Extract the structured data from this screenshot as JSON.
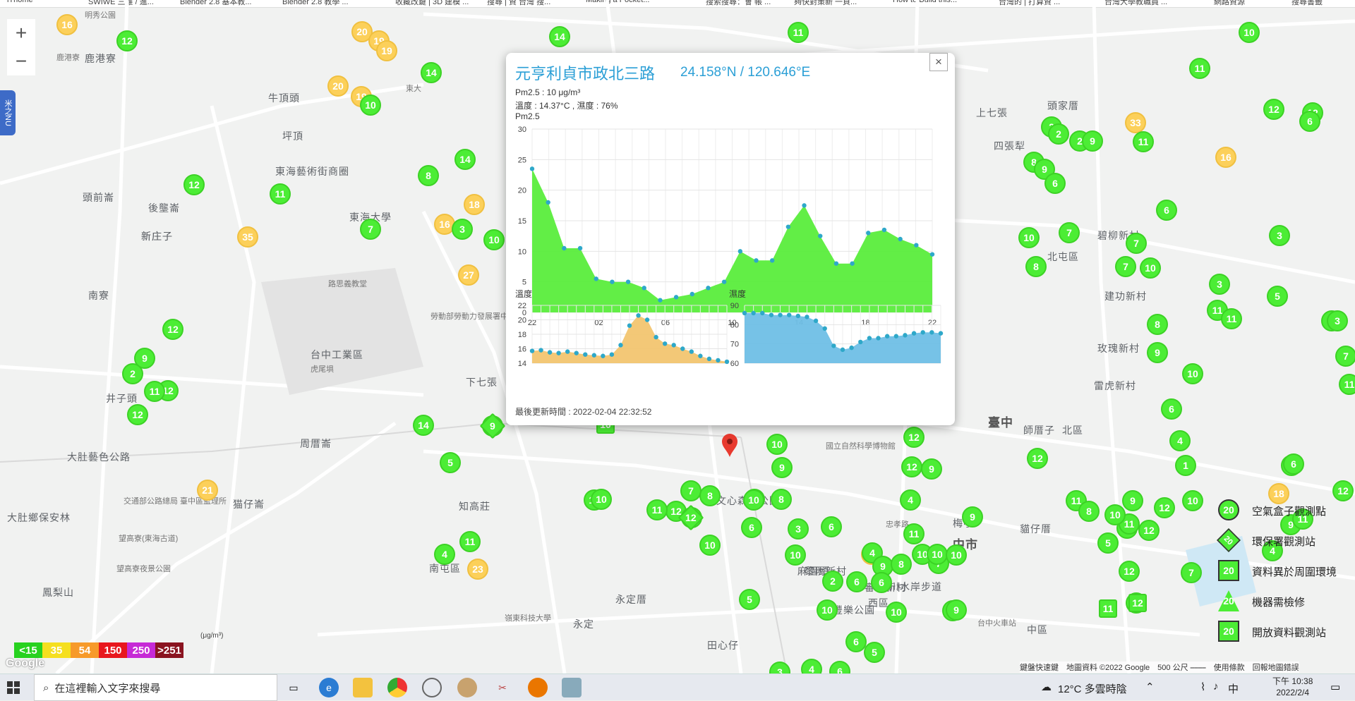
{
  "bookmarks": [
    "iThome",
    "SWIWE 三維 / 進...",
    "Blender 2.8 基本教...",
    "Blender 2.8 教學 ...",
    "收藏改鍵 | 3D 建模 ...",
    "搜尋 | 資 台灣 搜...",
    "Making a Pocket...",
    "搜索搜尋：會 帳 ...",
    "夠快對策新 一頁...",
    "How to Build this...",
    "台灣的 | 打算資 ...",
    "台灣大學教職員 ...",
    "網路資源",
    "搜尋書籤"
  ],
  "map": {
    "zoom_in": "+",
    "zoom_out": "−",
    "side_tab": "米之NU",
    "labels": [
      "明秀公園",
      "鹿港寮",
      "東大",
      "牛頂頭",
      "坪頂",
      "東海藝術街商圈",
      "頭前崙",
      "後壟崙",
      "新庄子",
      "南寮",
      "路思義教堂",
      "台中工業區",
      "虎尾埧",
      "井子頭",
      "周厝崙",
      "大肚藝色公路",
      "交通部公路總局 臺中區監理所",
      "大肚鄉保安林",
      "望高寮(東海古道)",
      "望高寮夜景公園",
      "鳳梨山",
      "勞動部勞動力發展署中彰投分署(臺中職訓局)",
      "下七張",
      "知高莊",
      "國立自然科學博物館",
      "中市",
      "臺中",
      "師厝子",
      "西區",
      "審計新村",
      "忠孝路",
      "梅亭",
      "北屯區",
      "北區",
      "四張犁",
      "上七張",
      "頭家厝",
      "碧柳新村",
      "玫瑰新村",
      "建功新村",
      "雷虎新村",
      "永定厝",
      "永定",
      "田心仔",
      "南屯區",
      "嶺東科技大學",
      "豐樂公園",
      "中區",
      "柳川水岸步道",
      "台中火車站",
      "鹿港寮",
      "麻園頭",
      "黎明新村",
      "文心森林公園",
      "新庄子",
      "猫仔崙",
      "東海大學",
      "貓仔厝"
    ],
    "marker_values": [
      "16",
      "12",
      "20",
      "19",
      "19",
      "20",
      "19",
      "10",
      "14",
      "14",
      "14",
      "11",
      "12",
      "11",
      "8",
      "7",
      "35",
      "18",
      "16",
      "27",
      "3",
      "10",
      "12",
      "12",
      "9",
      "2",
      "11",
      "12",
      "14",
      "5",
      "9",
      "21",
      "23",
      "4",
      "11",
      "10",
      "10",
      "12",
      "11",
      "7",
      "12",
      "8",
      "10",
      "6",
      "9",
      "10",
      "10",
      "8",
      "9",
      "5",
      "10",
      "4",
      "4",
      "9",
      "6",
      "6",
      "8",
      "4",
      "10",
      "11",
      "7",
      "10",
      "9",
      "10",
      "9",
      "10",
      "10",
      "2",
      "6",
      "5",
      "4",
      "6",
      "3",
      "3",
      "9",
      "12",
      "12",
      "9",
      "6",
      "12",
      "11",
      "8",
      "4",
      "12",
      "11",
      "4",
      "9",
      "8",
      "10",
      "1",
      "10",
      "6",
      "12",
      "9",
      "10",
      "5",
      "12",
      "11",
      "7",
      "18",
      "1",
      "6",
      "9",
      "4",
      "11",
      "12",
      "11",
      "7",
      "7",
      "3",
      "16",
      "33",
      "11",
      "2",
      "2",
      "2",
      "9",
      "8",
      "9",
      "6",
      "7",
      "10",
      "8",
      "7",
      "7",
      "6",
      "3",
      "11",
      "10",
      "5",
      "11",
      "12",
      "6",
      "11",
      "10",
      "12",
      "3",
      "11"
    ],
    "footer": "鍵盤快速鍵　地圖資料 ©2022 Google　500 公尺 ⎯⎯⎯⎯　使用條款　回報地圖錯誤",
    "google": "Google"
  },
  "popup": {
    "title": "元亨利貞市政北三路",
    "coords": "24.158°N / 120.646°E",
    "pm25_line": "Pm2.5 : 10 μg/m³",
    "temp_hum_line": "溫度 : 14.37°C , 濕度 : 76%",
    "chart_label": "Pm2.5",
    "temp_label": "溫度",
    "hum_label": "濕度",
    "updated": "最後更新時間 : 2022-02-04 22:32:52",
    "close": "×"
  },
  "chart_data": [
    {
      "type": "area",
      "title": "Pm2.5",
      "x": [
        "22",
        "",
        "",
        "",
        "02",
        "",
        "",
        "",
        "06",
        "",
        "",
        "",
        "10",
        "",
        "",
        "",
        "14",
        "",
        "",
        "",
        "18",
        "",
        "",
        "",
        "22"
      ],
      "x_ticks": [
        "22",
        "02",
        "06",
        "10",
        "14",
        "18",
        "22"
      ],
      "values": [
        23.5,
        18,
        10.5,
        10.5,
        5.5,
        5,
        5,
        4,
        2,
        2.5,
        3,
        4,
        5,
        10,
        8.5,
        8.5,
        14,
        17.5,
        12.5,
        8,
        8,
        13,
        13.5,
        12,
        11,
        9.5
      ],
      "ylim": [
        0,
        30
      ],
      "y_ticks": [
        0,
        5,
        10,
        15,
        20,
        25,
        30
      ],
      "color": "#5aed3c",
      "grid": true
    },
    {
      "type": "area",
      "title": "溫度",
      "values": [
        15.7,
        15.8,
        15.5,
        15.4,
        15.6,
        15.4,
        15.2,
        15.1,
        15.0,
        15.2,
        16.5,
        19.2,
        20.6,
        20.0,
        17.6,
        16.7,
        16.5,
        16.0,
        15.6,
        15.0,
        14.6,
        14.4,
        14.2
      ],
      "ylim": [
        14,
        22
      ],
      "y_ticks": [
        14,
        16,
        18,
        20,
        22
      ],
      "color": "#f2c570",
      "grid": true
    },
    {
      "type": "area",
      "title": "濕度",
      "values": [
        86,
        86,
        86,
        85,
        85,
        85,
        84.5,
        84,
        82,
        78,
        69,
        67,
        68,
        71,
        73,
        73,
        74,
        74,
        74.5,
        75.5,
        76,
        76,
        75.5
      ],
      "ylim": [
        60,
        90
      ],
      "y_ticks": [
        60,
        70,
        80,
        90
      ],
      "color": "#6fbfe6",
      "grid": true
    }
  ],
  "legend": {
    "scale": [
      {
        "label": "<15",
        "color": "#27d21f"
      },
      {
        "label": "35",
        "color": "#f5df1f"
      },
      {
        "label": "54",
        "color": "#f79a2a"
      },
      {
        "label": "150",
        "color": "#e8171d"
      },
      {
        "label": "250",
        "color": "#c62ad6"
      },
      {
        "label": ">251",
        "color": "#8a1420"
      }
    ],
    "unit": "(μg/m³)",
    "types": [
      {
        "icon": "20",
        "label": "空氣盒子觀測點"
      },
      {
        "icon": "20",
        "label": "環保署觀測站"
      },
      {
        "icon": "20",
        "label": "資料異於周圍環境"
      },
      {
        "icon": "20",
        "label": "機器需檢修"
      },
      {
        "icon": "20",
        "label": "開放資料觀測站"
      }
    ]
  },
  "taskbar": {
    "search_placeholder": "在這裡輸入文字來搜尋",
    "weather": "12°C 多雲時陰",
    "ime": "中",
    "time": "下午 10:38",
    "date": "2022/2/4"
  }
}
